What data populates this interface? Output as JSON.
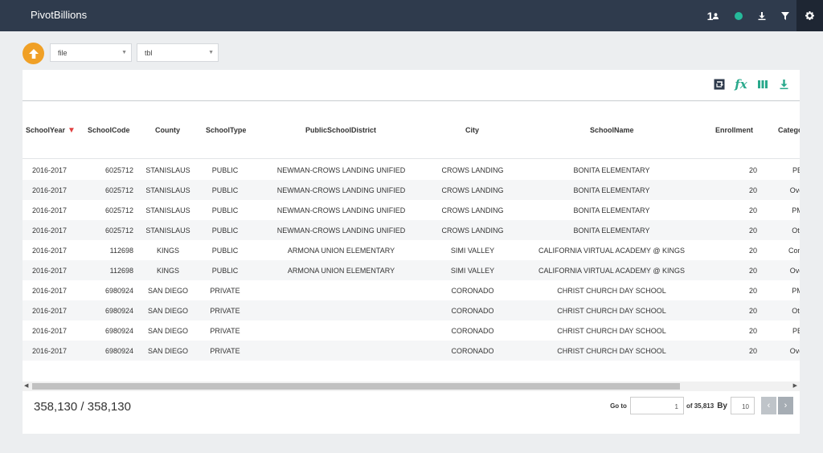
{
  "header": {
    "brand": "PivotBillions",
    "user_count": "1",
    "icons": [
      "user-icon",
      "status-dot",
      "download-icon",
      "filter-icon",
      "gear-icon"
    ]
  },
  "controls": {
    "file_select": "file",
    "tbl_select": "tbl"
  },
  "toolbar": {
    "fx_label": "fx",
    "icons": [
      "refresh-icon",
      "fx-icon",
      "columns-icon",
      "download-icon"
    ]
  },
  "table": {
    "columns": [
      "SchoolYear",
      "SchoolCode",
      "County",
      "SchoolType",
      "PublicSchoolDistrict",
      "City",
      "SchoolName",
      "Enrollment",
      "Catego"
    ],
    "rows": [
      [
        "2016-2017",
        "6025712",
        "STANISLAUS",
        "PUBLIC",
        "NEWMAN-CROWS LANDING UNIFIED",
        "CROWS LANDING",
        "BONITA ELEMENTARY",
        "20",
        "PBE"
      ],
      [
        "2016-2017",
        "6025712",
        "STANISLAUS",
        "PUBLIC",
        "NEWMAN-CROWS LANDING UNIFIED",
        "CROWS LANDING",
        "BONITA ELEMENTARY",
        "20",
        "Overd"
      ],
      [
        "2016-2017",
        "6025712",
        "STANISLAUS",
        "PUBLIC",
        "NEWMAN-CROWS LANDING UNIFIED",
        "CROWS LANDING",
        "BONITA ELEMENTARY",
        "20",
        "PME"
      ],
      [
        "2016-2017",
        "6025712",
        "STANISLAUS",
        "PUBLIC",
        "NEWMAN-CROWS LANDING UNIFIED",
        "CROWS LANDING",
        "BONITA ELEMENTARY",
        "20",
        "Othe"
      ],
      [
        "2016-2017",
        "112698",
        "KINGS",
        "PUBLIC",
        "ARMONA UNION ELEMENTARY",
        "SIMI VALLEY",
        "CALIFORNIA VIRTUAL ACADEMY @ KINGS",
        "20",
        "Conditi"
      ],
      [
        "2016-2017",
        "112698",
        "KINGS",
        "PUBLIC",
        "ARMONA UNION ELEMENTARY",
        "SIMI VALLEY",
        "CALIFORNIA VIRTUAL ACADEMY @ KINGS",
        "20",
        "Overd"
      ],
      [
        "2016-2017",
        "6980924",
        "SAN DIEGO",
        "PRIVATE",
        "",
        "CORONADO",
        "CHRIST CHURCH DAY SCHOOL",
        "20",
        "PME"
      ],
      [
        "2016-2017",
        "6980924",
        "SAN DIEGO",
        "PRIVATE",
        "",
        "CORONADO",
        "CHRIST CHURCH DAY SCHOOL",
        "20",
        "Othe"
      ],
      [
        "2016-2017",
        "6980924",
        "SAN DIEGO",
        "PRIVATE",
        "",
        "CORONADO",
        "CHRIST CHURCH DAY SCHOOL",
        "20",
        "PBE"
      ],
      [
        "2016-2017",
        "6980924",
        "SAN DIEGO",
        "PRIVATE",
        "",
        "CORONADO",
        "CHRIST CHURCH DAY SCHOOL",
        "20",
        "Overd"
      ]
    ]
  },
  "footer": {
    "total": "358,130  /  358,130",
    "goto_label": "Go to",
    "page_value": "1",
    "of_pages": "of 35,813",
    "by_label": "By",
    "per_page": "10",
    "prev": "‹",
    "next": "›"
  }
}
